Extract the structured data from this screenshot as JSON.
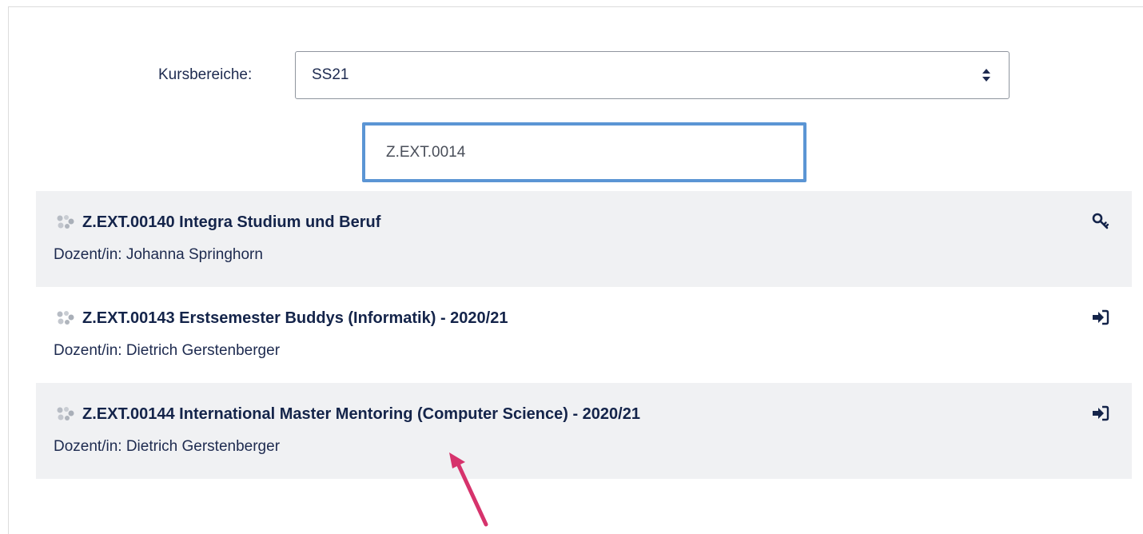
{
  "filter": {
    "label": "Kursbereiche:",
    "selected": "SS21"
  },
  "search": {
    "value": "Z.EXT.0014"
  },
  "courses": [
    {
      "title": "Z.EXT.00140 Integra Studium und Beruf",
      "teacher": "Dozent/in: Johanna Springhorn",
      "enrol_icon": "key-icon"
    },
    {
      "title": "Z.EXT.00143 Erstsemester Buddys (Informatik) - 2020/21",
      "teacher": "Dozent/in: Dietrich Gerstenberger",
      "enrol_icon": "sign-in-icon"
    },
    {
      "title": "Z.EXT.00144 International Master Mentoring (Computer Science) - 2020/21",
      "teacher": "Dozent/in: Dietrich Gerstenberger",
      "enrol_icon": "sign-in-icon"
    }
  ],
  "colors": {
    "title": "#14244a",
    "focus_border": "#5b95d4",
    "row_shade": "#f0f1f3",
    "annotation_arrow": "#d6336c"
  }
}
